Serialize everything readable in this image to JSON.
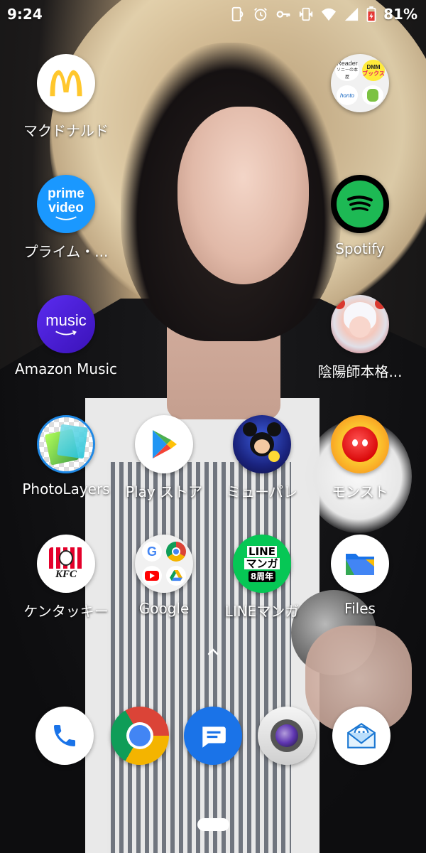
{
  "status_bar": {
    "time": "9:24",
    "battery_percent": "81%",
    "icons": [
      "nfc-icon",
      "alarm-icon",
      "vpn-key-icon",
      "vibrate-icon",
      "wifi-icon",
      "signal-icon",
      "battery-charging-icon"
    ]
  },
  "apps": [
    {
      "label": "マクドナルド",
      "icon": "mcdonalds-icon"
    },
    {
      "label": "",
      "icon": "folder-reader-icon",
      "folder": [
        "Reader",
        "ソニーの本屋",
        "DMM",
        "ブックス",
        "honto",
        "app-green"
      ]
    },
    {
      "label": "プライム・...",
      "icon": "prime-video-icon",
      "icon_text": [
        "prime",
        "video"
      ]
    },
    {
      "label": "Spotify",
      "icon": "spotify-icon"
    },
    {
      "label": "Amazon Music",
      "icon": "amazon-music-icon",
      "icon_text": "music"
    },
    {
      "label": "陰陽師本格...",
      "icon": "onmyoji-icon"
    },
    {
      "label": "PhotoLayers",
      "icon": "photolayers-icon"
    },
    {
      "label": "Play ストア",
      "icon": "play-store-icon"
    },
    {
      "label": "ミューパレ",
      "icon": "mickey-palace-icon"
    },
    {
      "label": "モンスト",
      "icon": "monster-strike-icon"
    },
    {
      "label": "ケンタッキー",
      "icon": "kfc-icon",
      "icon_text": "KFC"
    },
    {
      "label": "Google",
      "icon": "google-folder-icon"
    },
    {
      "label": "LINEマンガ",
      "icon": "line-manga-icon",
      "icon_text": [
        "LINE",
        "マンガ",
        "8周年"
      ]
    },
    {
      "label": "Files",
      "icon": "files-icon"
    }
  ],
  "dock": [
    {
      "icon": "phone-icon"
    },
    {
      "icon": "chrome-icon"
    },
    {
      "icon": "messages-icon"
    },
    {
      "icon": "camera-icon"
    },
    {
      "icon": "mail-app-icon"
    }
  ],
  "colors": {
    "mcdonalds_yellow": "#FFC72C",
    "prime_blue": "#1A98FF",
    "spotify_green": "#1DB954",
    "amazon_music_purple": "#4B1FD6",
    "kfc_red": "#E4002B",
    "line_green": "#06C755",
    "messages_blue": "#1A73E8"
  }
}
